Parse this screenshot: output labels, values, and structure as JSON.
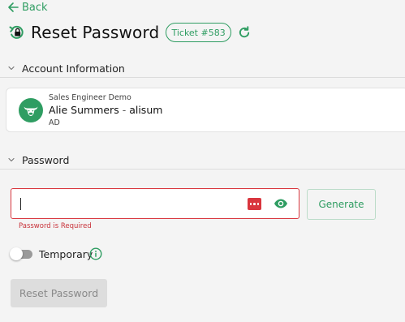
{
  "nav": {
    "back_label": "Back"
  },
  "header": {
    "title": "Reset Password",
    "ticket_badge": "Ticket #583"
  },
  "sections": {
    "account": "Account Information",
    "password": "Password"
  },
  "account": {
    "org": "Sales Engineer Demo",
    "name": "Alie Summers",
    "separator": "-",
    "username": "alisum",
    "source": "AD"
  },
  "password_form": {
    "value": "",
    "error": "Password is Required",
    "generate_label": "Generate",
    "temporary_label": "Temporary",
    "temporary_enabled": false,
    "reset_label": "Reset Password"
  },
  "colors": {
    "accent": "#2f9d62",
    "error": "#d9363e",
    "background": "#f4f4f4",
    "disabled_button": "#dddddd"
  },
  "icons": {
    "back": "arrow-left-icon",
    "title": "lock-reset-icon",
    "refresh": "refresh-icon",
    "chevron": "chevron-down-icon",
    "avatar": "bull-logo-icon",
    "password_manager": "password-dots-icon",
    "visibility": "eye-icon",
    "info": "info-icon"
  }
}
